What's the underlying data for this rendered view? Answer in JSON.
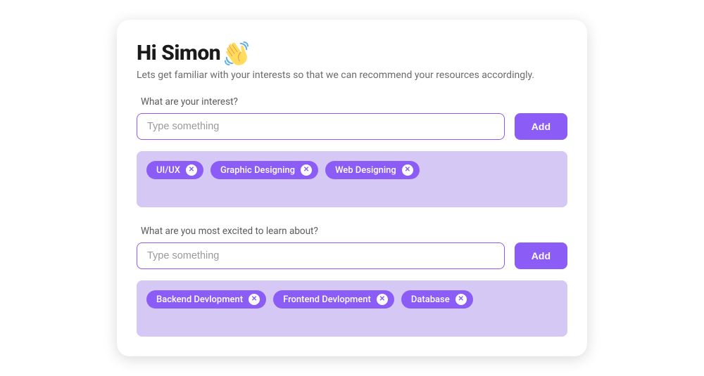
{
  "header": {
    "title": "Hi Simon",
    "subtitle": "Lets get familiar with your interests so that we can recommend your resources accordingly."
  },
  "sections": {
    "interests": {
      "label": "What are your interest?",
      "placeholder": "Type something",
      "add_label": "Add",
      "chips": [
        {
          "label": "UI/UX"
        },
        {
          "label": "Graphic Designing"
        },
        {
          "label": "Web Designing"
        }
      ]
    },
    "excited": {
      "label": "What are you most excited to learn about?",
      "placeholder": "Type something",
      "add_label": "Add",
      "chips": [
        {
          "label": "Backend Devlopment"
        },
        {
          "label": "Frontend Devlopment"
        },
        {
          "label": "Database"
        }
      ]
    }
  },
  "colors": {
    "accent": "#8b5cf6",
    "chip_bg": "#d6c8f5"
  }
}
